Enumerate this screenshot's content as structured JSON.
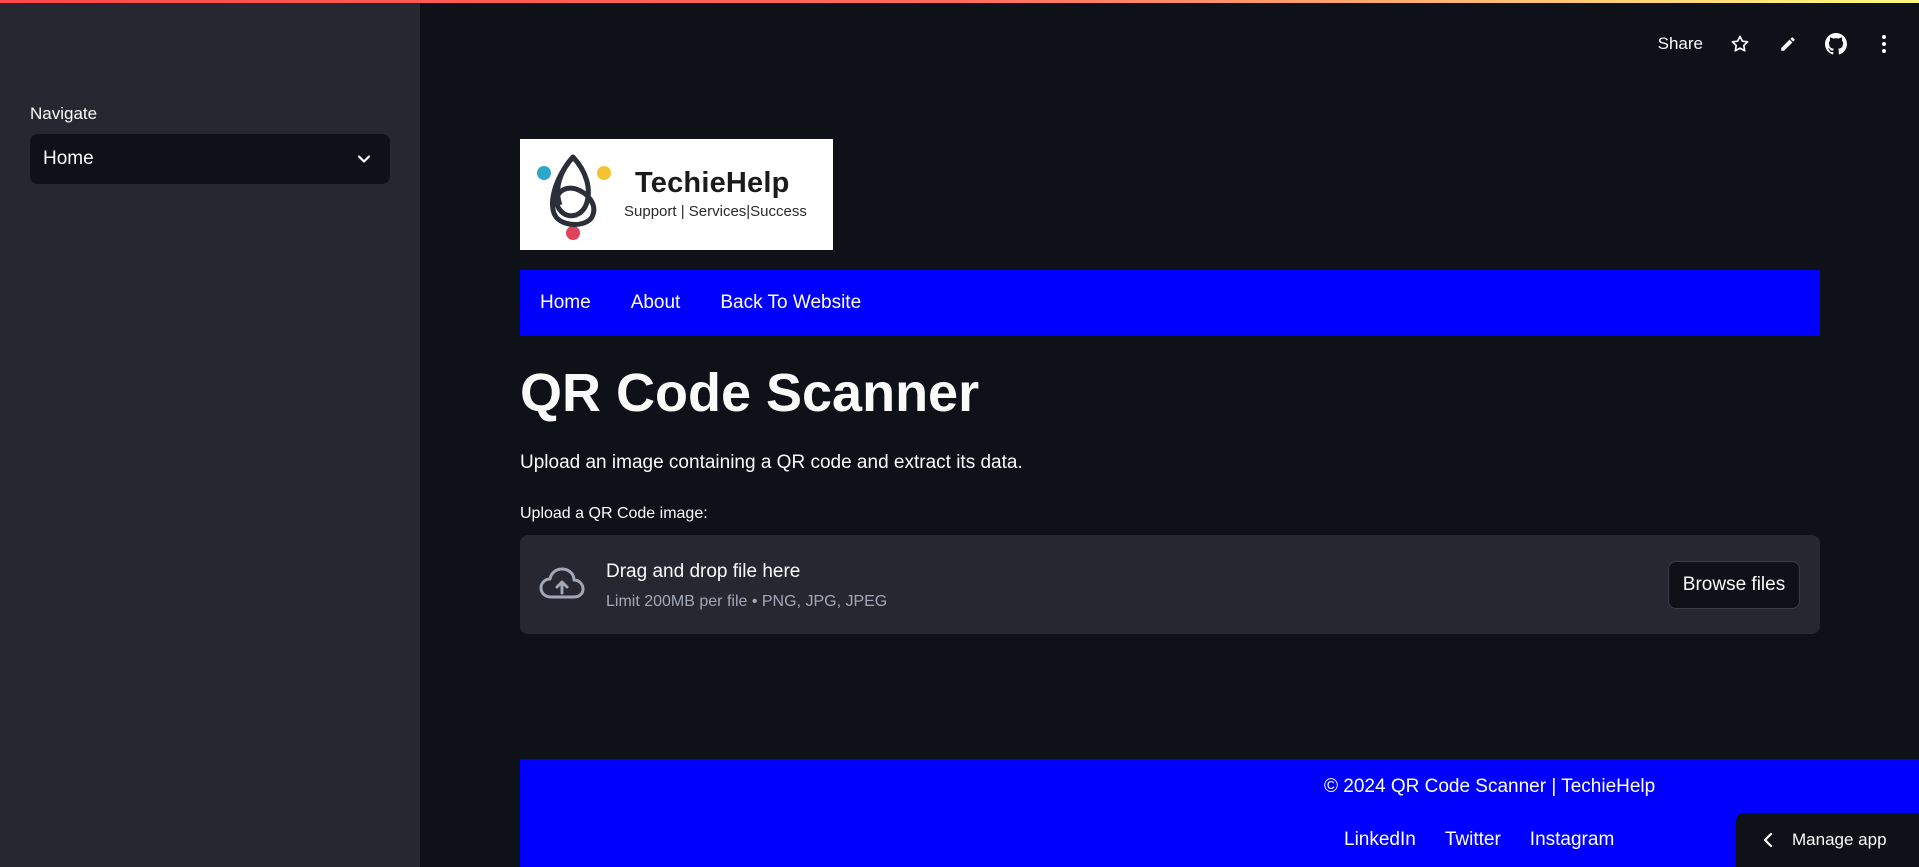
{
  "sidebar": {
    "nav_label": "Navigate",
    "nav_selected": "Home"
  },
  "toolbar": {
    "share_label": "Share",
    "icons": [
      "star-icon",
      "pencil-icon",
      "github-icon",
      "more-vertical-icon"
    ]
  },
  "logo": {
    "title": "TechieHelp",
    "tagline": "Support | Services|Success"
  },
  "navbar": {
    "links": [
      "Home",
      "About",
      "Back To Website"
    ]
  },
  "main": {
    "title": "QR Code Scanner",
    "description": "Upload an image containing a QR code and extract its data.",
    "upload_label": "Upload a QR Code image:",
    "dropzone_title": "Drag and drop file here",
    "dropzone_sub": "Limit 200MB per file • PNG, JPG, JPEG",
    "browse_label": "Browse files"
  },
  "footer": {
    "copyright": "© 2024 QR Code Scanner | TechieHelp",
    "links": [
      "LinkedIn",
      "Twitter",
      "Instagram"
    ]
  },
  "manage_app": {
    "label": "Manage app"
  },
  "colors": {
    "accent_blue": "#0000ff",
    "sidebar_bg": "#262730",
    "main_bg": "#0e1117"
  }
}
